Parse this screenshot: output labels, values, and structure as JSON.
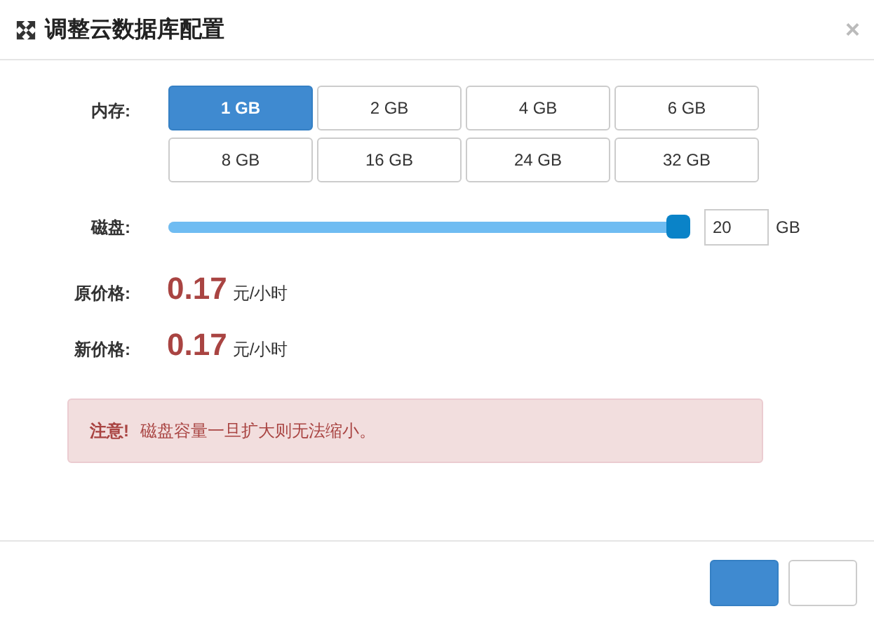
{
  "window": {
    "title": "调整云数据库配置",
    "close": "×"
  },
  "memory": {
    "label": "内存:",
    "options": [
      {
        "label": "1 GB",
        "selected": true
      },
      {
        "label": "2 GB",
        "selected": false
      },
      {
        "label": "4 GB",
        "selected": false
      },
      {
        "label": "6 GB",
        "selected": false
      },
      {
        "label": "8 GB",
        "selected": false
      },
      {
        "label": "16 GB",
        "selected": false
      },
      {
        "label": "24 GB",
        "selected": false
      },
      {
        "label": "32 GB",
        "selected": false
      }
    ]
  },
  "disk": {
    "label": "磁盘:",
    "level": 1,
    "value": "20",
    "unit": "GB"
  },
  "prices": [
    {
      "label": "原价格:",
      "amount": "0.17",
      "unit": "元/小时"
    },
    {
      "label": "新价格:",
      "amount": "0.17",
      "unit": "元/小时"
    }
  ],
  "alert": {
    "title": "注意!",
    "message": "磁盘容量一旦扩大则无法缩小。"
  },
  "footer_buttons": [
    {
      "kind": "primary"
    },
    {
      "kind": "default"
    }
  ]
}
